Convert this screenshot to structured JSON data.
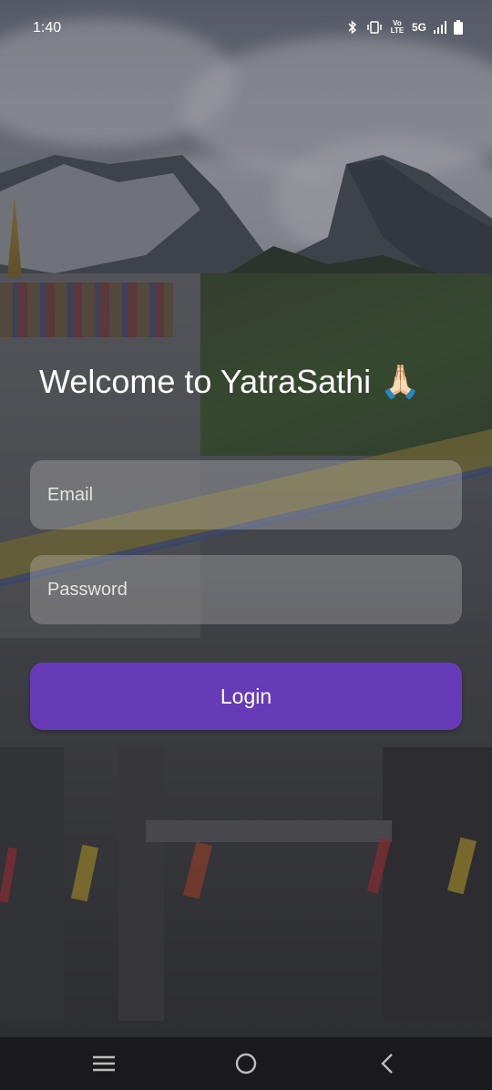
{
  "status_bar": {
    "time": "1:40",
    "icons": [
      "bluetooth-icon",
      "vibrate-icon",
      "volte-icon",
      "5g-icon",
      "signal-icon",
      "battery-icon"
    ],
    "volte_label": "Vo LTE",
    "network_label": "5G"
  },
  "login": {
    "title": "Welcome to YatraSathi 🙏🏻",
    "email_placeholder": "Email",
    "password_placeholder": "Password",
    "login_label": "Login",
    "accent_color": "#673ab7"
  },
  "nav_bar": {
    "items": [
      "recents-icon",
      "home-icon",
      "back-icon"
    ]
  }
}
